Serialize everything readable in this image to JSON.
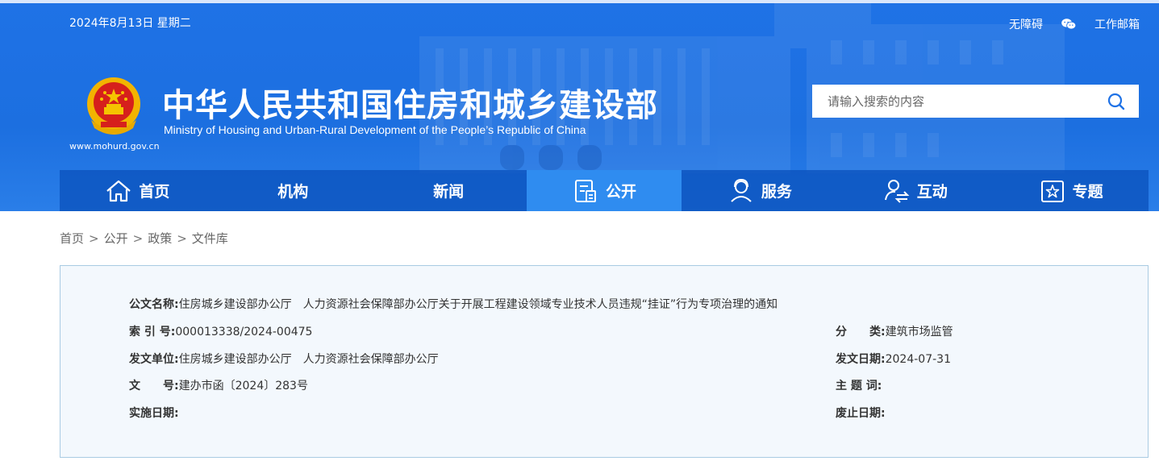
{
  "header": {
    "date": "2024年8月13日 星期二",
    "links": [
      "无障碍",
      "工作邮箱"
    ],
    "site_url": "www.mohurd.gov.cn",
    "title_cn": "中华人民共和国住房和城乡建设部",
    "title_en": "Ministry of Housing and Urban-Rural Development of the People’s Republic of China",
    "search_placeholder": "请输入搜索的内容"
  },
  "nav": {
    "items": [
      {
        "label": "首页",
        "icon": "home-icon"
      },
      {
        "label": "机构",
        "icon": ""
      },
      {
        "label": "新闻",
        "icon": ""
      },
      {
        "label": "公开",
        "icon": "document-icon",
        "active": true
      },
      {
        "label": "服务",
        "icon": "service-user-icon"
      },
      {
        "label": "互动",
        "icon": "interaction-icon"
      },
      {
        "label": "专题",
        "icon": "star-icon"
      }
    ]
  },
  "breadcrumb": [
    "首页",
    "公开",
    "政策",
    "文件库"
  ],
  "document": {
    "title_label": "公文名称:",
    "title_value": "住房城乡建设部办公厅　人力资源社会保障部办公厅关于开展工程建设领域专业技术人员违规“挂证”行为专项治理的通知",
    "index_label": "索 引 号:",
    "index_value": "000013338/2024-00475",
    "category_label": "分　　类:",
    "category_value": "建筑市场监管",
    "issuer_label": "发文单位:",
    "issuer_value": "住房城乡建设部办公厅　人力资源社会保障部办公厅",
    "issue_date_label": "发文日期:",
    "issue_date_value": "2024-07-31",
    "number_label": "文　　号:",
    "number_value": "建办市函〔2024〕283号",
    "keywords_label": "主 题 词:",
    "keywords_value": "",
    "effective_label": "实施日期:",
    "effective_value": "",
    "expiry_label": "废止日期:",
    "expiry_value": ""
  },
  "colors": {
    "header_blue": "#1f72e6",
    "nav_blue": "#0c54be",
    "nav_active": "#2f8cf0",
    "info_bg": "#f3f8fd",
    "info_border": "#a9cbe3"
  }
}
